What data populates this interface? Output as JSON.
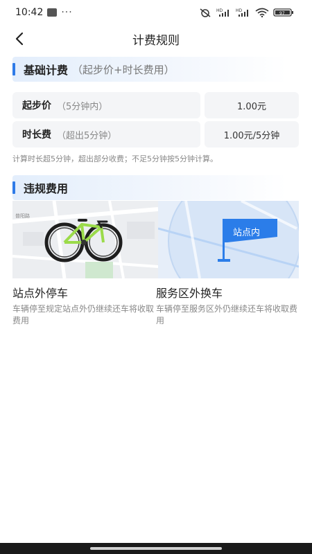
{
  "status_bar": {
    "time": "10:42",
    "more": "···",
    "battery": "97"
  },
  "nav": {
    "title": "计费规则"
  },
  "basic": {
    "title": "基础计费",
    "subtitle": "（起步价+时长费用）",
    "rows": [
      {
        "name": "起步价",
        "note": "（5分钟内）",
        "price": "1.00元"
      },
      {
        "name": "时长费",
        "note": "（超出5分钟）",
        "price": "1.00元/5分钟"
      }
    ],
    "note": "计算时长超5分钟，超出部分收费；不足5分钟按5分钟计算。"
  },
  "violation": {
    "title": "违规费用",
    "map_label": "普阳路",
    "flag_label": "站点内",
    "cases": [
      {
        "title": "站点外停车",
        "desc": "车辆停至规定站点外仍继续还车将收取费用"
      },
      {
        "title": "服务区外换车",
        "desc": "车辆停至服务区外仍继续还车将收取费用"
      }
    ]
  },
  "colors": {
    "accent": "#2f7be8",
    "flag": "#2b7de9",
    "cell_bg": "#f4f5f7"
  }
}
